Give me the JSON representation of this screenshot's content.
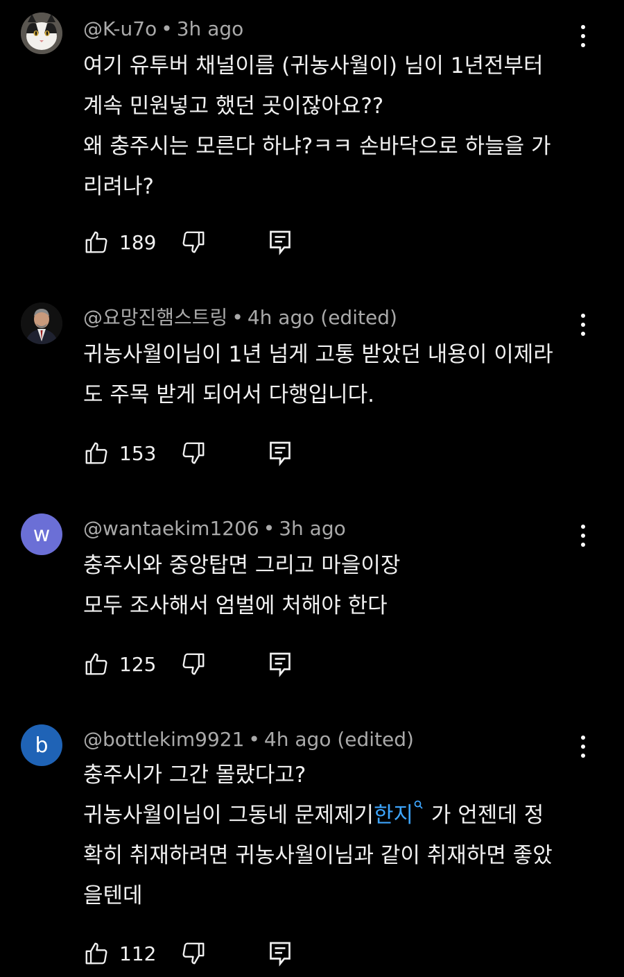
{
  "comments": [
    {
      "handle": "@K-u7o",
      "separator": "•",
      "time": "3h ago",
      "edited": "",
      "avatar_type": "cat-photo",
      "lines": [
        "여기 유투버 채널이름 (귀농사월이) 님이 1년전부터",
        "계속 민원넣고 했던 곳이잖아요??",
        "왜 충주시는 모른다 하냐?ㅋㅋ 손바닥으로 하늘을 가",
        "리려나?"
      ],
      "likes": "189"
    },
    {
      "handle": "@요망진햄스트링",
      "separator": "•",
      "time": "4h ago",
      "edited": "(edited)",
      "avatar_type": "man-in-suit-photo",
      "lines": [
        "귀농사월이님이 1년 넘게 고통 받았던 내용이 이제라",
        "도 주목 받게 되어서 다행입니다."
      ],
      "likes": "153"
    },
    {
      "handle": "@wantaekim1206",
      "separator": "•",
      "time": "3h ago",
      "edited": "",
      "avatar_letter": "w",
      "avatar_color": "#6b6fd6",
      "lines": [
        "충주시와 중앙탑면 그리고 마을이장",
        "모두 조사해서 엄벌에 처해야 한다"
      ],
      "likes": "125"
    },
    {
      "handle": "@bottlekim9921",
      "separator": "•",
      "time": "4h ago",
      "edited": "(edited)",
      "avatar_letter": "b",
      "avatar_color": "#1f63b6",
      "line1": "충주시가 그간 몰랐다고?",
      "line2_before": "귀농사월이님이 그동네 문제제기",
      "line2_link": "한지",
      "line2_after": "가 언젠데 정",
      "line3": "확히 취재하려면 귀농사월이님과 같이 취재하면 좋았",
      "line4": "을텐데",
      "likes": "112"
    }
  ],
  "icons": {
    "like": "thumbs-up-icon",
    "dislike": "thumbs-down-icon",
    "reply": "reply-comment-icon",
    "more": "more-vertical-icon",
    "search": "search-icon"
  },
  "colors": {
    "background": "#000000",
    "text": "#f1f1f1",
    "meta": "#aaaaaa",
    "link": "#3ea6ff"
  }
}
